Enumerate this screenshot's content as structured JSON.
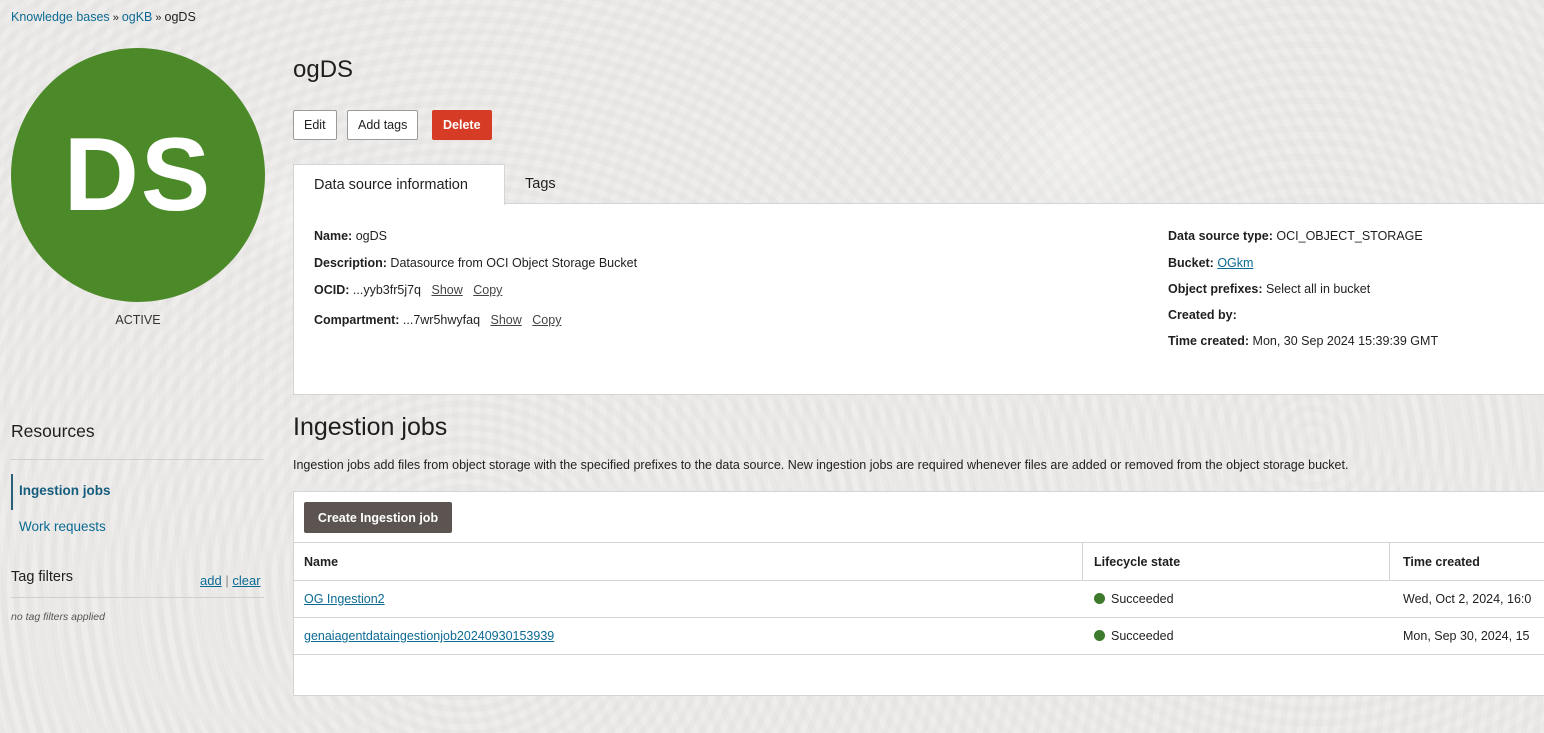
{
  "breadcrumb": {
    "items": [
      "Knowledge bases",
      "ogKB",
      "ogDS"
    ],
    "separator": "»"
  },
  "avatar": {
    "initials": "DS",
    "color": "#4c8a29",
    "status": "ACTIVE"
  },
  "header": {
    "title": "ogDS"
  },
  "actions": {
    "edit": "Edit",
    "add_tags": "Add tags",
    "delete": "Delete"
  },
  "tabs": [
    {
      "label": "Data source information",
      "active": true
    },
    {
      "label": "Tags",
      "active": false
    }
  ],
  "info": {
    "name_label": "Name:",
    "name": "ogDS",
    "description_label": "Description:",
    "description": "Datasource from OCI Object Storage Bucket",
    "ocid_label": "OCID:",
    "ocid": "...yyb3fr5j7q",
    "compartment_label": "Compartment:",
    "compartment": "...7wr5hwyfaq",
    "show": "Show",
    "copy": "Copy",
    "type_label": "Data source type:",
    "type": "OCI_OBJECT_STORAGE",
    "bucket_label": "Bucket:",
    "bucket": "OGkm",
    "prefixes_label": "Object prefixes:",
    "prefixes": "Select all in bucket",
    "created_by_label": "Created by:",
    "created_by": "",
    "time_created_label": "Time created:",
    "time_created": "Mon, 30 Sep 2024 15:39:39 GMT"
  },
  "resources": {
    "title": "Resources",
    "items": [
      {
        "label": "Ingestion jobs",
        "active": true
      },
      {
        "label": "Work requests",
        "active": false
      }
    ]
  },
  "tag_filters": {
    "title": "Tag filters",
    "add": "add",
    "divider": "|",
    "clear": "clear",
    "empty": "no tag filters applied"
  },
  "ingestion": {
    "title": "Ingestion jobs",
    "description": "Ingestion jobs add files from object storage with the specified prefixes to the data source. New ingestion jobs are required whenever files are added or removed from the object storage bucket.",
    "create_button": "Create Ingestion job",
    "columns": [
      "Name",
      "Lifecycle state",
      "Time created"
    ],
    "rows": [
      {
        "name": "OG Ingestion2",
        "state": "Succeeded",
        "time": "Wed, Oct 2, 2024, 16:0"
      },
      {
        "name": "genaiagentdataingestionjob20240930153939",
        "state": "Succeeded",
        "time": "Mon, Sep 30, 2024, 15"
      }
    ]
  },
  "colors": {
    "accent": "#0c6a93",
    "danger": "#d63b25",
    "success": "#3d7a2c",
    "primary_button": "#5b5450"
  }
}
